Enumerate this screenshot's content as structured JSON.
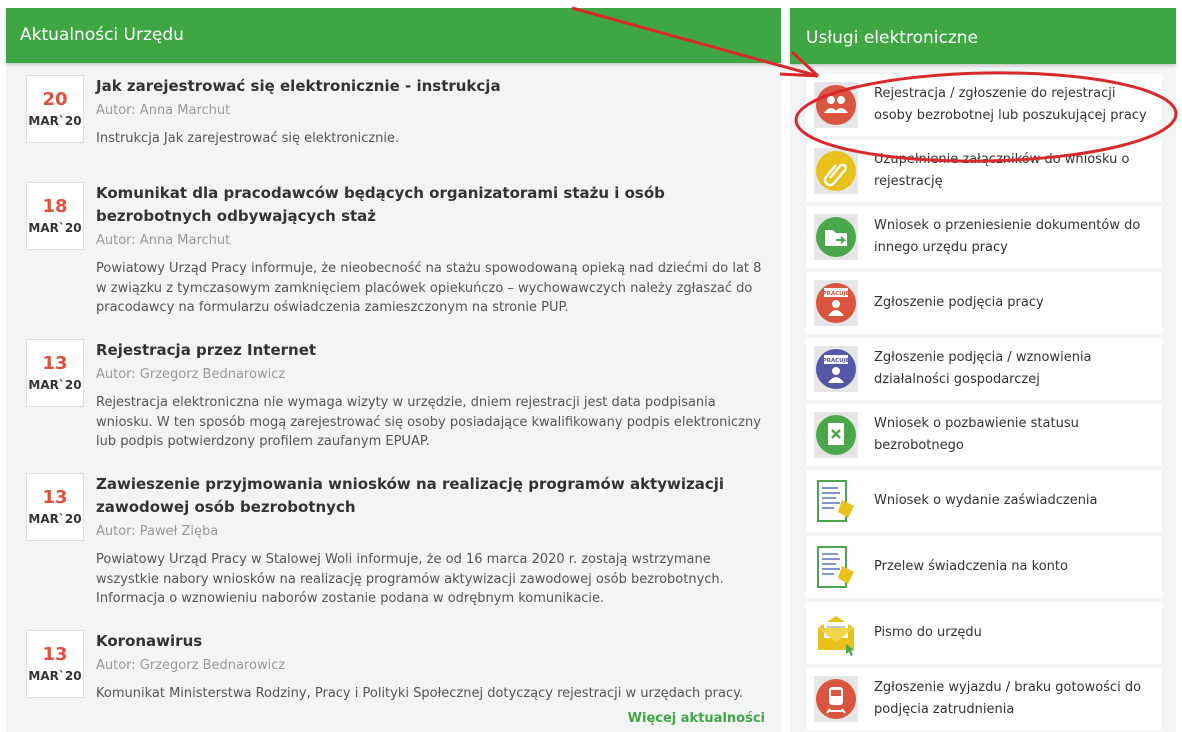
{
  "news": {
    "header": "Aktualności Urzędu",
    "more_label": "Więcej aktualności",
    "items": [
      {
        "day": "20",
        "month": "MAR`20",
        "title": "Jak zarejestrować się elektronicznie - instrukcja",
        "author": "Autor: Anna Marchut",
        "text": "Instrukcja Jak zarejestrować się elektronicznie."
      },
      {
        "day": "18",
        "month": "MAR`20",
        "title": "Komunikat dla pracodawców będących organizatorami stażu i osób bezrobotnych odbywających staż",
        "author": "Autor: Anna Marchut",
        "text": "Powiatowy Urząd Pracy informuje, że nieobecność na stażu spowodowaną opieką nad dziećmi do lat 8 w związku z tymczasowym zamknięciem placówek opiekuńczo – wychowawczych należy zgłaszać do pracodawcy na formularzu oświadczenia zamieszczonym na stronie PUP."
      },
      {
        "day": "13",
        "month": "MAR`20",
        "title": "Rejestracja przez Internet",
        "author": "Autor: Grzegorz Bednarowicz",
        "text": "Rejestracja elektroniczna nie wymaga wizyty w urzędzie, dniem rejestracji jest data podpisania wniosku. W ten sposób mogą zarejestrować się osoby posiadające kwalifikowany podpis elektroniczny lub podpis potwierdzony profilem zaufanym EPUAP."
      },
      {
        "day": "13",
        "month": "MAR`20",
        "title": "Zawieszenie przyjmowania wniosków na realizację programów aktywizacji zawodowej osób bezrobotnych",
        "author": "Autor: Paweł Zięba",
        "text": "Powiatowy Urząd Pracy w Stalowej Woli informuje, że od 16 marca 2020 r. zostają wstrzymane wszystkie nabory wniosków na realizację programów aktywizacji zawodowej osób bezrobotnych. Informacja o wznowieniu naborów zostanie podana w odrębnym komunikacie."
      },
      {
        "day": "13",
        "month": "MAR`20",
        "title": "Koronawirus",
        "author": "Autor: Grzegorz Bednarowicz",
        "text": "Komunikat Ministerstwa Rodziny, Pracy i Polityki Społecznej dotyczący rejestracji w urzędach pracy."
      }
    ]
  },
  "services": {
    "header": "Usługi elektroniczne",
    "items": [
      {
        "label": "Rejestracja / zgłoszenie do rejestracji osoby bezrobotnej lub poszukującej pracy",
        "icon": "people-icon",
        "color": "#d9553f"
      },
      {
        "label": "Uzupełnienie załączników do wniosku o rejestrację",
        "icon": "paperclip-icon",
        "color": "#e8c21a"
      },
      {
        "label": "Wniosek o przeniesienie dokumentów do innego urzędu pracy",
        "icon": "folder-transfer-icon",
        "color": "#4aa84b"
      },
      {
        "label": "Zgłoszenie podjęcia pracy",
        "icon": "worker-badge-icon",
        "color": "#d9553f",
        "badge": "PRACUJĘ"
      },
      {
        "label": "Zgłoszenie podjęcia / wznowienia działalności gospodarczej",
        "icon": "business-badge-icon",
        "color": "#5557a8",
        "badge": "PRACUJĘ"
      },
      {
        "label": "Wniosek o pozbawienie statusu bezrobotnego",
        "icon": "document-x-icon",
        "color": "#4aa84b"
      },
      {
        "label": "Wniosek o wydanie zaświadczenia",
        "icon": "certificate-form-icon",
        "color": "#4aa84b"
      },
      {
        "label": "Przelew świadczenia na konto",
        "icon": "transfer-form-icon",
        "color": "#4aa84b"
      },
      {
        "label": "Pismo do urzędu",
        "icon": "envelope-icon",
        "color": "#e8c21a"
      },
      {
        "label": "Zgłoszenie wyjazdu / braku gotowości do podjęcia zatrudnienia",
        "icon": "train-icon",
        "color": "#d9553f"
      }
    ]
  }
}
